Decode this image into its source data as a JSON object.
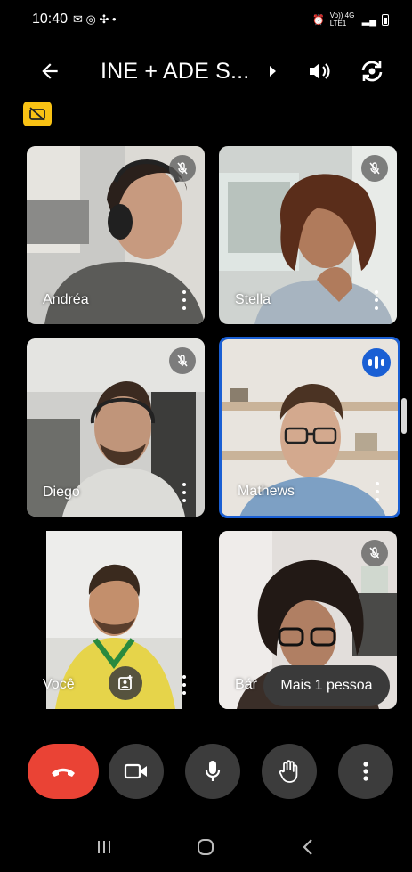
{
  "status_bar": {
    "time": "10:40",
    "signal_text": "Vo)) 4G LTE1"
  },
  "header": {
    "meeting_title": "INE + ADE S..."
  },
  "participants": [
    {
      "name": "Andréa",
      "muted": true,
      "speaking": false
    },
    {
      "name": "Stella",
      "muted": true,
      "speaking": false
    },
    {
      "name": "Diego",
      "muted": true,
      "speaking": false
    },
    {
      "name": "Mathews",
      "muted": false,
      "speaking": true
    },
    {
      "name": "Você",
      "muted": false,
      "speaking": false,
      "self": true
    },
    {
      "name": "Bár",
      "muted": true,
      "speaking": false
    }
  ],
  "overflow": {
    "label": "Mais 1 pessoa"
  },
  "controls": {
    "end_call": "phone-hangup-icon",
    "camera": "video-camera-icon",
    "microphone": "microphone-icon",
    "raise_hand": "hand-icon",
    "more": "more-vert-icon"
  },
  "colors": {
    "end_call": "#ea4335",
    "active_speaker": "#1a5fd4",
    "notice_badge": "#f9c214",
    "control_bg": "#3c3c3c"
  }
}
